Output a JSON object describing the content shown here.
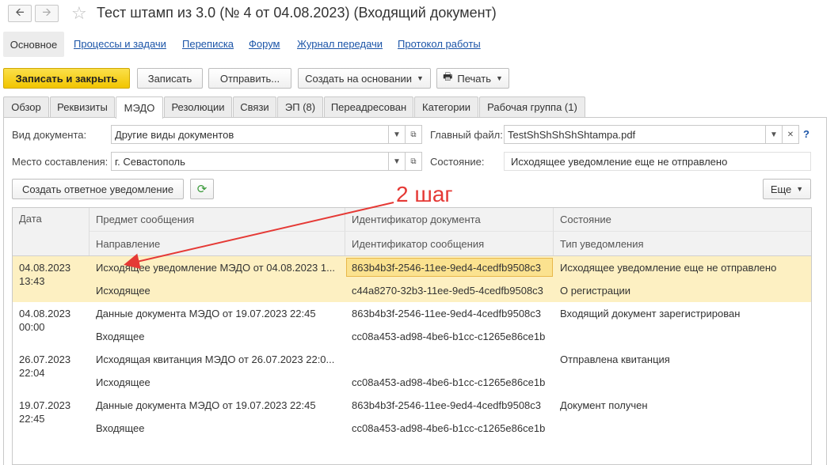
{
  "window": {
    "title": "Тест штамп из 3.0 (№ 4 от 04.08.2023) (Входящий документ)",
    "back_icon": "arrow-left",
    "forward_icon": "arrow-right",
    "favorite_icon": "star"
  },
  "nav": {
    "active": "Основное",
    "links": [
      "Процессы и задачи",
      "Переписка",
      "Форум",
      "Журнал передачи",
      "Протокол работы"
    ]
  },
  "toolbar": {
    "save_close": "Записать и закрыть",
    "save": "Записать",
    "send": "Отправить...",
    "create_based": "Создать на основании",
    "print": "Печать"
  },
  "tabs": [
    "Обзор",
    "Реквизиты",
    "МЭДО",
    "Резолюции",
    "Связи",
    "ЭП (8)",
    "Переадресован",
    "Категории",
    "Рабочая группа (1)"
  ],
  "active_tab": "МЭДО",
  "form": {
    "doc_type_label": "Вид документа:",
    "doc_type_value": "Другие виды документов",
    "place_label": "Место составления:",
    "place_value": "г. Севастополь",
    "main_file_label": "Главный файл:",
    "main_file_value": "TestShShShShShtampa.pdf",
    "state_label": "Состояние:",
    "state_value": "Исходящее уведомление еще не отправлено",
    "help": "?"
  },
  "actions": {
    "create_reply": "Создать ответное уведомление",
    "more": "Еще"
  },
  "annotation": "2 шаг",
  "table": {
    "headers": {
      "date": "Дата",
      "subject": "Предмет сообщения",
      "direction": "Направление",
      "doc_id": "Идентификатор документа",
      "msg_id": "Идентификатор сообщения",
      "state": "Состояние",
      "notice_type": "Тип уведомления"
    },
    "rows": [
      {
        "date": "04.08.2023",
        "time": "13:43",
        "subject": "Исходящее уведомление МЭДО от 04.08.2023 1...",
        "direction": "Исходящее",
        "doc_id": "863b4b3f-2546-11ee-9ed4-4cedfb9508c3",
        "msg_id": "c44a8270-32b3-11ee-9ed5-4cedfb9508c3",
        "state": "Исходящее уведомление еще не отправлено",
        "notice_type": "О регистрации"
      },
      {
        "date": "04.08.2023",
        "time": "00:00",
        "subject": "Данные документа МЭДО от 19.07.2023 22:45",
        "direction": "Входящее",
        "doc_id": "863b4b3f-2546-11ee-9ed4-4cedfb9508c3",
        "msg_id": "cc08a453-ad98-4be6-b1cc-c1265e86ce1b",
        "state": "Входящий документ зарегистрирован",
        "notice_type": ""
      },
      {
        "date": "26.07.2023",
        "time": "22:04",
        "subject": "Исходящая квитанция МЭДО от 26.07.2023 22:0...",
        "direction": "Исходящее",
        "doc_id": "",
        "msg_id": "cc08a453-ad98-4be6-b1cc-c1265e86ce1b",
        "state": "Отправлена квитанция",
        "notice_type": ""
      },
      {
        "date": "19.07.2023",
        "time": "22:45",
        "subject": "Данные документа МЭДО от 19.07.2023 22:45",
        "direction": "Входящее",
        "doc_id": "863b4b3f-2546-11ee-9ed4-4cedfb9508c3",
        "msg_id": "cc08a453-ad98-4be6-b1cc-c1265e86ce1b",
        "state": "Документ получен",
        "notice_type": ""
      }
    ]
  },
  "colors": {
    "accent": "#f1c500",
    "selected_row": "#fdf0c2",
    "selected_cell": "#fbe28f",
    "annotation": "#e53935",
    "link": "#1c55a8"
  }
}
